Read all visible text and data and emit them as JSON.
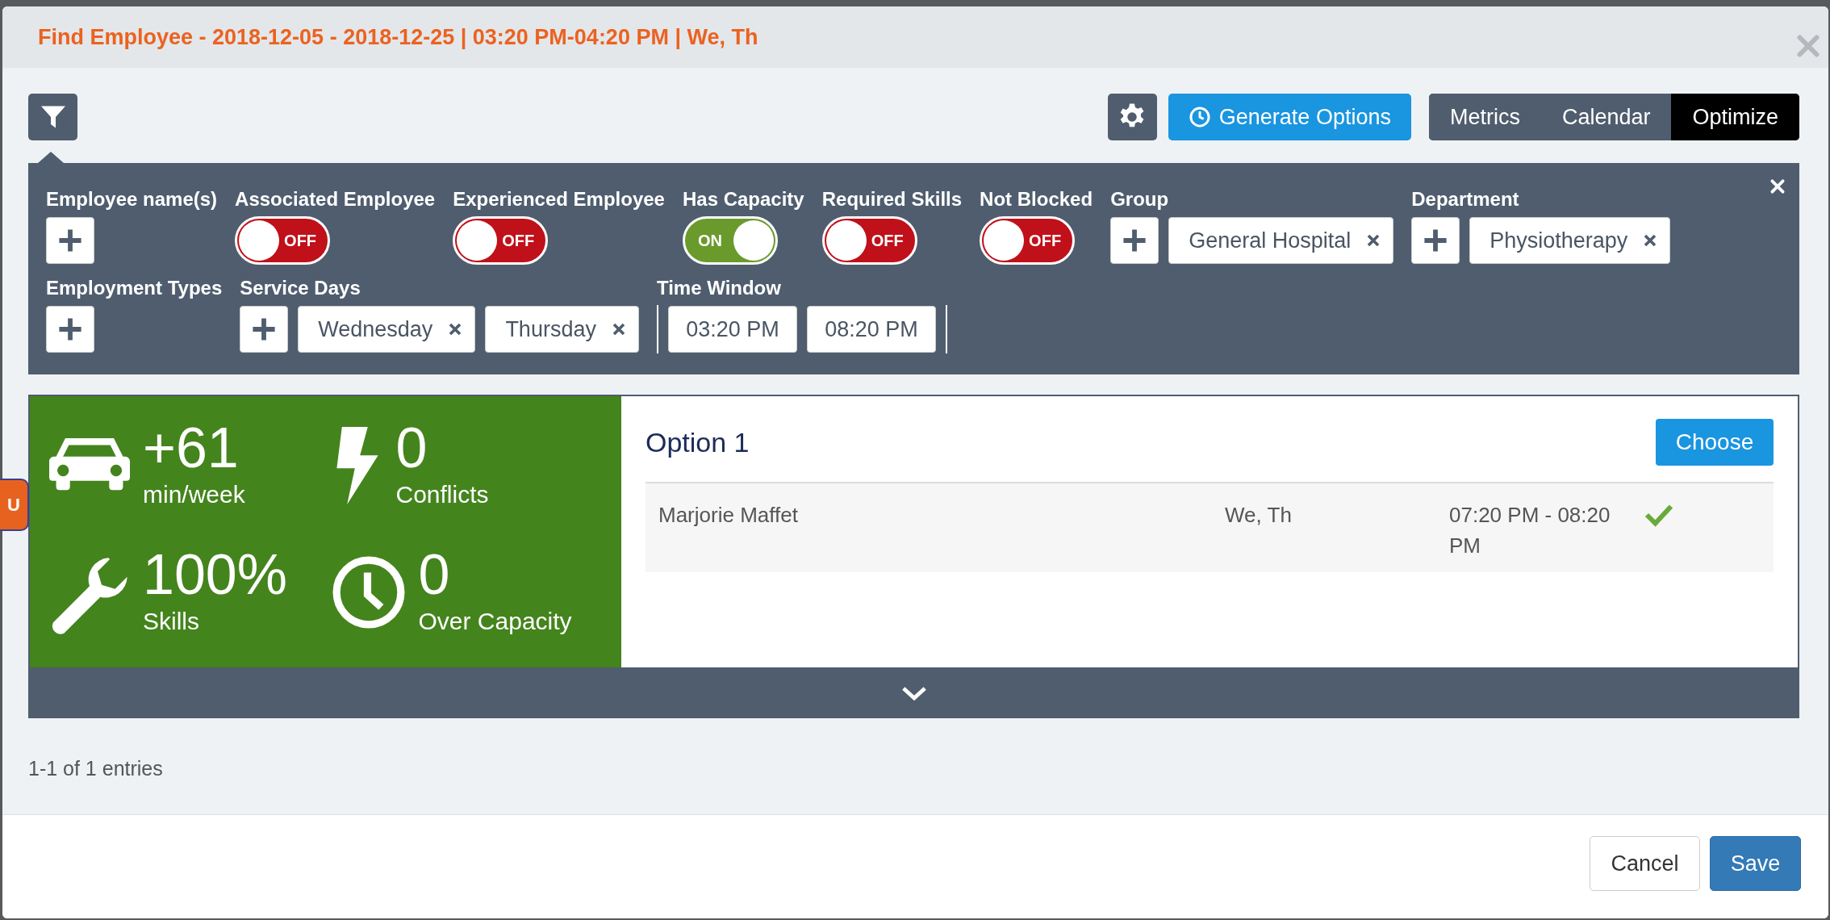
{
  "window": {
    "title": "Find Employee - 2018-12-05 - 2018-12-25 | 03:20 PM-04:20 PM | We, Th"
  },
  "side_badge": "U",
  "toolbar": {
    "generate_button": "Generate Options",
    "view_tabs": [
      {
        "label": "Metrics",
        "selected": false
      },
      {
        "label": "Calendar",
        "selected": false
      },
      {
        "label": "Optimize",
        "selected": true
      }
    ]
  },
  "filters": {
    "fields": [
      {
        "label": "Employee name(s)",
        "kind": "add"
      },
      {
        "label": "Associated Employee",
        "kind": "toggle",
        "on": false,
        "text": "OFF"
      },
      {
        "label": "Experienced Employee",
        "kind": "toggle",
        "on": false,
        "text": "OFF"
      },
      {
        "label": "Has Capacity",
        "kind": "toggle",
        "on": true,
        "text": "ON"
      },
      {
        "label": "Required Skills",
        "kind": "toggle",
        "on": false,
        "text": "OFF"
      },
      {
        "label": "Not Blocked",
        "kind": "toggle",
        "on": false,
        "text": "OFF"
      },
      {
        "label": "Group",
        "kind": "add",
        "chips": [
          "General Hospital"
        ]
      },
      {
        "label": "Department",
        "kind": "add",
        "chips": [
          "Physiotherapy"
        ]
      },
      {
        "label": "Employment Types",
        "kind": "add"
      },
      {
        "label": "Service Days",
        "kind": "add",
        "chips": [
          "Wednesday",
          "Thursday"
        ]
      },
      {
        "label": "Time Window",
        "kind": "time",
        "values": [
          "03:20 PM",
          "08:20 PM"
        ]
      }
    ]
  },
  "metrics": [
    {
      "kind": "car",
      "value": "+61",
      "label": "min/week"
    },
    {
      "kind": "bolt",
      "value": "0",
      "label": "Conflicts"
    },
    {
      "kind": "wrench",
      "value": "100%",
      "label": "Skills"
    },
    {
      "kind": "clock",
      "value": "0",
      "label": "Over Capacity"
    }
  ],
  "option": {
    "title": "Option 1",
    "button": "Choose",
    "rows": [
      {
        "name": "Marjorie Maffet",
        "days": "We, Th",
        "time": "07:20 PM - 08:20 PM",
        "matched": true
      }
    ]
  },
  "entries": "1-1 of 1 entries",
  "footer": {
    "cancel": "Cancel",
    "save": "Save"
  }
}
